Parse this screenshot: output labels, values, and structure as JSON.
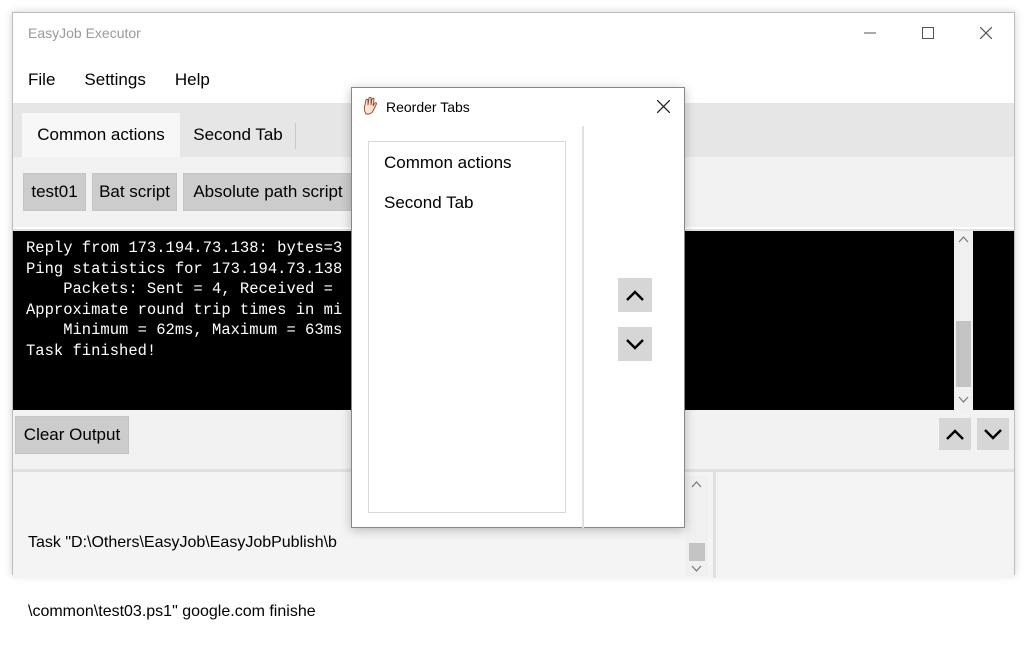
{
  "window": {
    "title": "EasyJob Executor"
  },
  "menu": {
    "items": [
      "File",
      "Settings",
      "Help"
    ]
  },
  "tabs": [
    {
      "label": "Common actions",
      "active": true
    },
    {
      "label": "Second Tab",
      "active": false
    }
  ],
  "actions": [
    "test01",
    "Bat script",
    "Absolute path script"
  ],
  "console": {
    "lines": [
      "Reply from 173.194.73.138: bytes=3",
      "Ping statistics for 173.194.73.138",
      "    Packets: Sent = 4, Received = ",
      "Approximate round trip times in mi",
      "    Minimum = 62ms, Maximum = 63ms",
      "",
      "Task finished!"
    ]
  },
  "output": {
    "clear_label": "Clear Output",
    "status_lines": [
      "Task \"D:\\Others\\EasyJob\\EasyJobPublish\\b",
      "\\common\\test03.ps1\" google.com finishe"
    ]
  },
  "dialog": {
    "title": "Reorder Tabs",
    "items": [
      "Common actions",
      "Second Tab"
    ]
  },
  "colors": {
    "console_bg": "#000000",
    "button_bg": "#cccccc",
    "tab_bar_bg": "#e6e6e6"
  }
}
